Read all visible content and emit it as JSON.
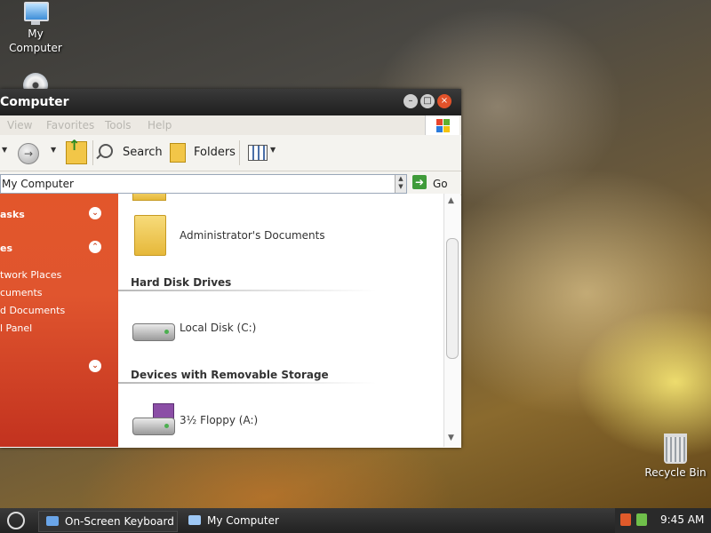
{
  "desktop": {
    "icons": [
      {
        "label": "My Computer",
        "icon": "my-computer-icon"
      },
      {
        "label": "",
        "icon": "cd-drive-icon"
      },
      {
        "label": "Recycle Bin",
        "icon": "recycle-bin-icon"
      }
    ]
  },
  "window": {
    "title": "Computer",
    "menu": [
      "View",
      "Favorites",
      "Tools",
      "Help"
    ],
    "toolbar": {
      "back_label": "",
      "search_label": "Search",
      "folders_label": "Folders"
    },
    "address": {
      "value": "My Computer",
      "go_label": "Go"
    },
    "sidebar": {
      "headers": [
        "asks",
        "es"
      ],
      "links": [
        "twork Places",
        "cuments",
        "d Documents",
        "l Panel"
      ]
    },
    "content": {
      "items": [
        {
          "section": "",
          "label": "Administrator's Documents",
          "icon": "folder-icon"
        },
        {
          "section": "Hard Disk Drives",
          "label": "Local Disk (C:)",
          "icon": "hard-disk-icon"
        },
        {
          "section": "Devices with Removable Storage",
          "label": "3½ Floppy (A:)",
          "icon": "floppy-drive-icon"
        }
      ]
    }
  },
  "taskbar": {
    "tasks": [
      {
        "label": "On-Screen Keyboard",
        "icon": "keyboard-icon",
        "active": true
      },
      {
        "label": "My Computer",
        "icon": "my-computer-icon",
        "active": false
      }
    ],
    "clock": "9:45 AM"
  },
  "colors": {
    "sidebar_accent": "#e0552e",
    "close_button": "#e2522a",
    "taskbar": "#2a2a2a"
  }
}
